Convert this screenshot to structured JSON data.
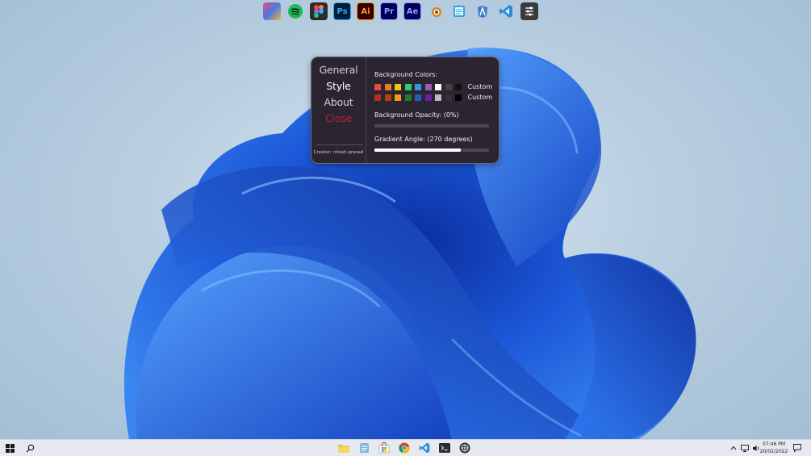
{
  "dock": {
    "apps": [
      {
        "name": "winaero-tweaker",
        "icon": "tweaker-icon"
      },
      {
        "name": "spotify",
        "icon": "spotify-icon",
        "color": "#1db954"
      },
      {
        "name": "figma",
        "icon": "figma-icon"
      },
      {
        "name": "photoshop",
        "label": "Ps",
        "color": "#31a8ff",
        "bg": "#001e36"
      },
      {
        "name": "illustrator",
        "label": "Ai",
        "color": "#ff9a00",
        "bg": "#330000"
      },
      {
        "name": "premiere-pro",
        "label": "Pr",
        "color": "#9999ff",
        "bg": "#00005b"
      },
      {
        "name": "after-effects",
        "label": "Ae",
        "color": "#9999ff",
        "bg": "#00005b"
      },
      {
        "name": "blender",
        "icon": "blender-icon"
      },
      {
        "name": "notepad",
        "icon": "notepad-icon"
      },
      {
        "name": "android-studio",
        "icon": "android-studio-icon"
      },
      {
        "name": "vscode",
        "icon": "vscode-icon",
        "color": "#2b8bd9"
      },
      {
        "name": "settings-tweaks",
        "icon": "sliders-icon"
      }
    ]
  },
  "panel": {
    "nav": {
      "general": "General",
      "style": "Style",
      "about": "About",
      "close": "Close"
    },
    "creator": "Creator: nitesh-prasad",
    "background_colors_label": "Background Colors:",
    "swatches_row1": [
      "#e74c3c",
      "#e67e22",
      "#f1c40f",
      "#2ecc71",
      "#3498db",
      "#9b59b6",
      "#ffffff",
      "#444444",
      "#111111"
    ],
    "swatches_row2": [
      "#b92d20",
      "#c0391b",
      "#f39c12",
      "#1e7b33",
      "#1f5fb8",
      "#6a1fa5",
      "#bbbbbb",
      "#333333",
      "#000000"
    ],
    "custom_label_1": "Custom",
    "custom_label_2": "Custom",
    "opacity_label": "Background Opacity: (0%)",
    "opacity_percent": 0,
    "angle_label": "Gradient Angle: (270 degrees)",
    "angle_fraction": 0.75
  },
  "taskbar": {
    "apps": [
      "file-explorer",
      "notepad",
      "microsoft-store",
      "chrome",
      "vscode",
      "terminal",
      "github-desktop"
    ],
    "time": "07:46 PM",
    "date": "20/02/2022"
  }
}
